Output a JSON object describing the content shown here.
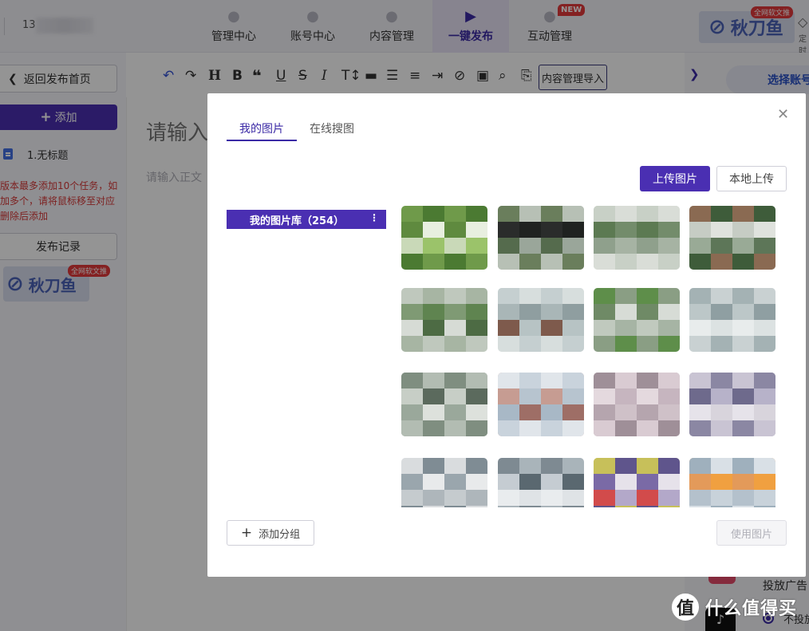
{
  "topnav": {
    "user_id": "13",
    "tabs": [
      {
        "label": "管理中心",
        "icon": "management-icon"
      },
      {
        "label": "账号中心",
        "icon": "account-icon"
      },
      {
        "label": "内容管理",
        "icon": "content-icon"
      },
      {
        "label": "一键发布",
        "icon": "publish-icon"
      },
      {
        "label": "互动管理",
        "icon": "interaction-icon"
      }
    ],
    "active_tab": "一键发布",
    "new_badge": "NEW",
    "logo_text": "秋刀鱼",
    "logo_badge": "全网软文推",
    "timer_label": "定时"
  },
  "sidebar": {
    "back_label": "返回发布首页",
    "add_label": "添加",
    "task_label": "1.无标题",
    "warning": "版本最多添加10个任务，如加多个，请将鼠标移至对应删除后添加",
    "history_label": "发布记录",
    "logo_text": "秋刀鱼",
    "logo_badge": "全网软文推"
  },
  "toolbar": {
    "icons": [
      "undo-icon",
      "redo-icon",
      "heading-icon",
      "bold-icon",
      "quote-icon",
      "underline-icon",
      "strikethrough-icon",
      "italic-icon",
      "font-size-icon",
      "divider-icon",
      "bullet-list-icon",
      "align-left-icon",
      "indent-icon",
      "clear-format-icon",
      "image-icon",
      "search-icon",
      "export-icon"
    ],
    "import_label": "内容管理导入"
  },
  "editor": {
    "title_placeholder": "请输入",
    "body_placeholder": "请输入正文"
  },
  "right_panel": {
    "select_account_label": "选择账号",
    "ad_label": "投放广告",
    "radio_label": "不投放"
  },
  "modal": {
    "tabs": [
      "我的图片",
      "在线搜图"
    ],
    "active_tab": "我的图片",
    "upload_label": "上传图片",
    "local_upload_label": "本地上传",
    "library_label": "我的图片库（254）",
    "add_group_label": "添加分组",
    "use_image_label": "使用图片",
    "thumbnails": [
      {
        "colors": [
          "#6f9a4a",
          "#9bc36a",
          "#e8efe0",
          "#4b7a32",
          "#c9d9b8",
          "#5f8a3f"
        ]
      },
      {
        "colors": [
          "#2a2c2b",
          "#6a7e5c",
          "#9aa69a",
          "#1f2220",
          "#b7c0b5",
          "#556b4d"
        ]
      },
      {
        "colors": [
          "#8fa08c",
          "#5c7a52",
          "#c8d0c6",
          "#a6b3a3",
          "#738c6b",
          "#d9ddd7"
        ]
      },
      {
        "colors": [
          "#3e5c3a",
          "#99aa96",
          "#c6ccc4",
          "#8a6a52",
          "#5d7658",
          "#dfe2dd"
        ]
      },
      {
        "colors": [
          "#5f8450",
          "#a7b5a3",
          "#d6dbd5",
          "#7f9a74",
          "#bfc8bd",
          "#4d6b44"
        ]
      },
      {
        "colors": [
          "#b7c3c4",
          "#8f9ea0",
          "#d7dedd",
          "#7e5a4c",
          "#a9b6b7",
          "#c5cfd0"
        ]
      },
      {
        "colors": [
          "#5e8e4a",
          "#a6b4a4",
          "#d7dcd6",
          "#8a9e84",
          "#c0c9be",
          "#6f8a66"
        ]
      },
      {
        "colors": [
          "#bcc7c8",
          "#a4b2b4",
          "#dce2e2",
          "#8f9fa2",
          "#c9d1d2",
          "#e8ecec"
        ]
      },
      {
        "colors": [
          "#9aa89b",
          "#c7cec6",
          "#7f8e80",
          "#dde1dc",
          "#5b6a5d",
          "#b2bcb2"
        ]
      },
      {
        "colors": [
          "#c9d3dc",
          "#a8b8c6",
          "#c69c92",
          "#e0e5ea",
          "#9e6e66",
          "#b7c4cf"
        ]
      },
      {
        "colors": [
          "#c6b5bf",
          "#d9cbd2",
          "#b5a5ae",
          "#e4d9de",
          "#9f8f98",
          "#cfc1c8"
        ]
      },
      {
        "colors": [
          "#d8d4dc",
          "#b7b2c9",
          "#8b87a3",
          "#e6e3ea",
          "#6e6a8c",
          "#c9c4d3"
        ]
      },
      {
        "colors": [
          "#d9dcde",
          "#aeb6bb",
          "#e8eaeb",
          "#7f8c94",
          "#c5cbce",
          "#9aa6ad"
        ]
      },
      {
        "colors": [
          "#c5ccd2",
          "#7e8a92",
          "#dfe3e6",
          "#5a6870",
          "#a9b4ba",
          "#e9ecee"
        ]
      },
      {
        "colors": [
          "#d24b4b",
          "#7a6aa6",
          "#c7c05a",
          "#b3a8c9",
          "#e6e2ea",
          "#5f558c"
        ]
      },
      {
        "colors": [
          "#d9e0e6",
          "#b4c1cc",
          "#e39a5a",
          "#9fb0bd",
          "#c8d2da",
          "#f0a040"
        ]
      }
    ]
  },
  "watermark": {
    "glyph": "值",
    "text": "什么值得买"
  }
}
